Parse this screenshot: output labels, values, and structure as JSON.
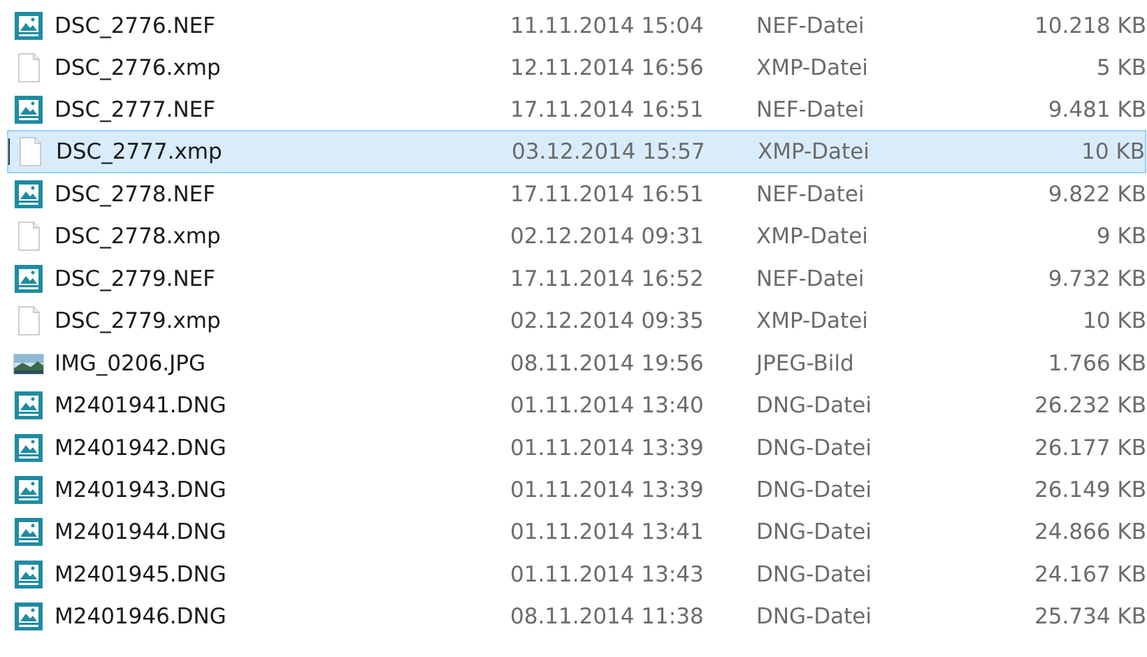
{
  "selected_index": 3,
  "files": [
    {
      "name": "DSC_2776.NEF",
      "date": "11.11.2014 15:04",
      "type": "NEF-Datei",
      "size": "10.218 KB",
      "icon": "image-file-icon"
    },
    {
      "name": "DSC_2776.xmp",
      "date": "12.11.2014 16:56",
      "type": "XMP-Datei",
      "size": "5 KB",
      "icon": "blank-file-icon"
    },
    {
      "name": "DSC_2777.NEF",
      "date": "17.11.2014 16:51",
      "type": "NEF-Datei",
      "size": "9.481 KB",
      "icon": "image-file-icon"
    },
    {
      "name": "DSC_2777.xmp",
      "date": "03.12.2014 15:57",
      "type": "XMP-Datei",
      "size": "10 KB",
      "icon": "blank-file-icon"
    },
    {
      "name": "DSC_2778.NEF",
      "date": "17.11.2014 16:51",
      "type": "NEF-Datei",
      "size": "9.822 KB",
      "icon": "image-file-icon"
    },
    {
      "name": "DSC_2778.xmp",
      "date": "02.12.2014 09:31",
      "type": "XMP-Datei",
      "size": "9 KB",
      "icon": "blank-file-icon"
    },
    {
      "name": "DSC_2779.NEF",
      "date": "17.11.2014 16:52",
      "type": "NEF-Datei",
      "size": "9.732 KB",
      "icon": "image-file-icon"
    },
    {
      "name": "DSC_2779.xmp",
      "date": "02.12.2014 09:35",
      "type": "XMP-Datei",
      "size": "10 KB",
      "icon": "blank-file-icon"
    },
    {
      "name": "IMG_0206.JPG",
      "date": "08.11.2014 19:56",
      "type": "JPEG-Bild",
      "size": "1.766 KB",
      "icon": "jpeg-thumbnail-icon"
    },
    {
      "name": "M2401941.DNG",
      "date": "01.11.2014 13:40",
      "type": "DNG-Datei",
      "size": "26.232 KB",
      "icon": "image-file-icon"
    },
    {
      "name": "M2401942.DNG",
      "date": "01.11.2014 13:39",
      "type": "DNG-Datei",
      "size": "26.177 KB",
      "icon": "image-file-icon"
    },
    {
      "name": "M2401943.DNG",
      "date": "01.11.2014 13:39",
      "type": "DNG-Datei",
      "size": "26.149 KB",
      "icon": "image-file-icon"
    },
    {
      "name": "M2401944.DNG",
      "date": "01.11.2014 13:41",
      "type": "DNG-Datei",
      "size": "24.866 KB",
      "icon": "image-file-icon"
    },
    {
      "name": "M2401945.DNG",
      "date": "01.11.2014 13:43",
      "type": "DNG-Datei",
      "size": "24.167 KB",
      "icon": "image-file-icon"
    },
    {
      "name": "M2401946.DNG",
      "date": "08.11.2014 11:38",
      "type": "DNG-Datei",
      "size": "25.734 KB",
      "icon": "image-file-icon"
    }
  ],
  "colors": {
    "selection_bg": "#d9ecfb",
    "selection_border": "#99d1f6",
    "icon_teal": "#1f8ba3"
  }
}
